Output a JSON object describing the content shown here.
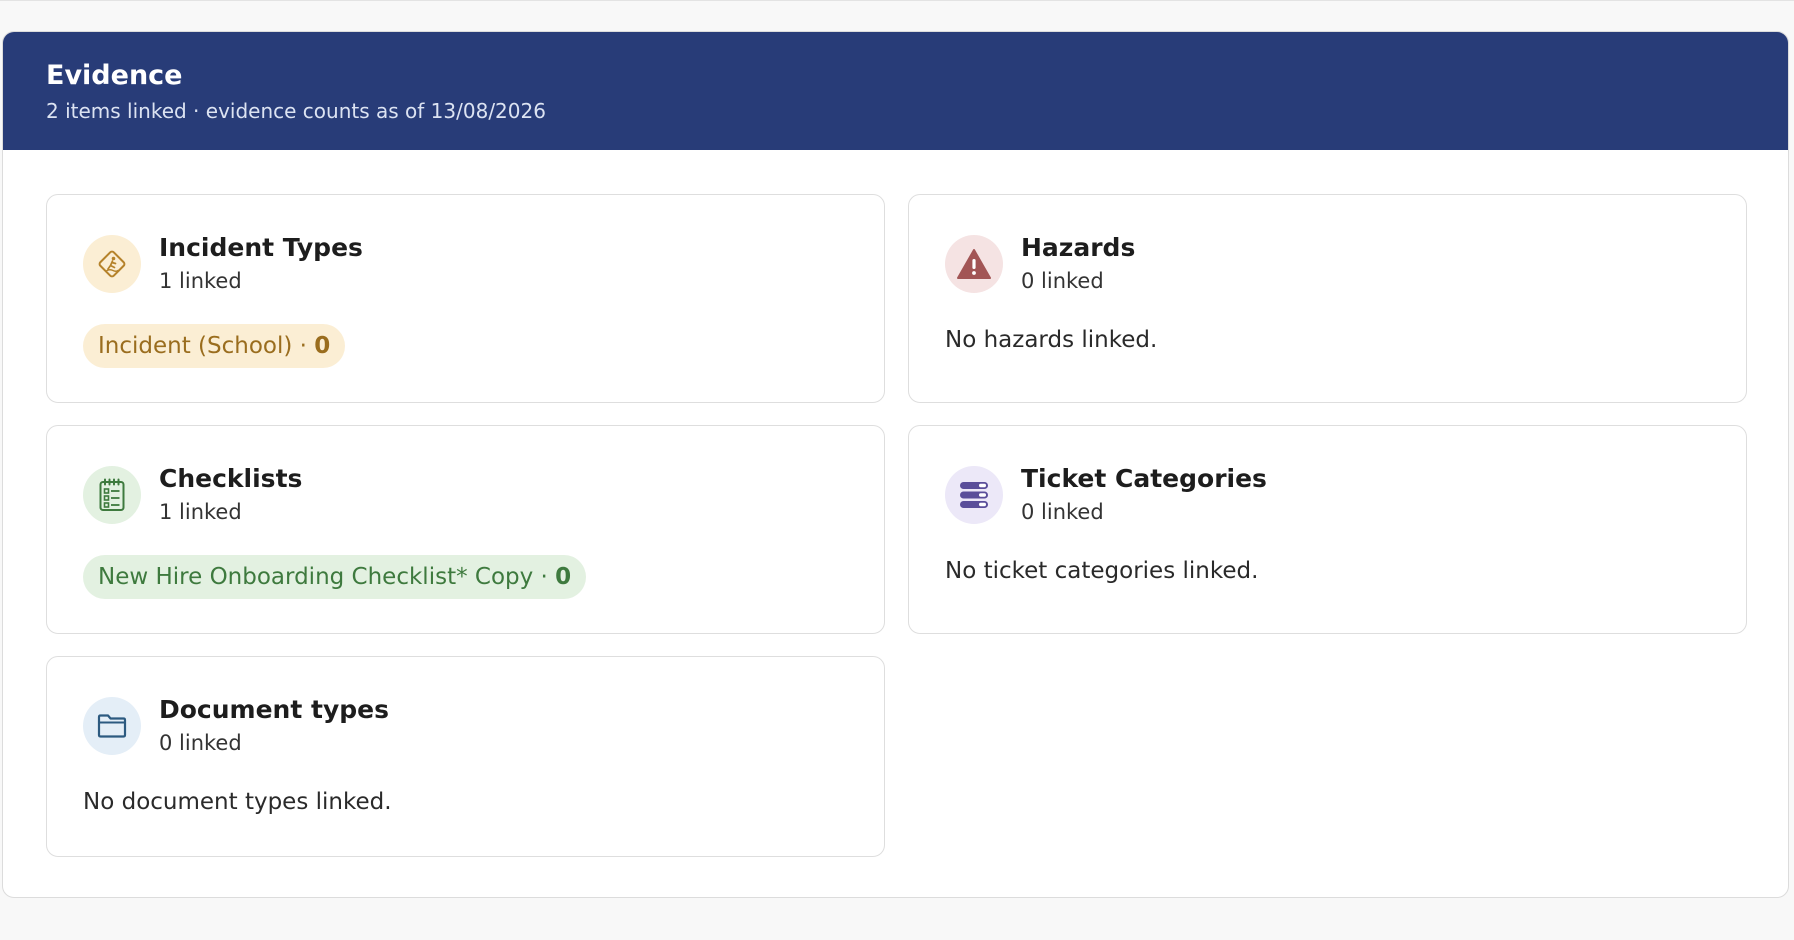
{
  "header": {
    "title": "Evidence",
    "subtitle": "2 items linked · evidence counts as of 13/08/2026"
  },
  "colors": {
    "header_bg": "#283c78",
    "incident_accent": "#9a6d1e",
    "incident_bg": "#fbeed4",
    "hazard_accent": "#a25555",
    "hazard_bg": "#f5e3e3",
    "checklist_accent": "#3e7a3e",
    "checklist_bg": "#e3f1e1",
    "ticket_accent": "#5a4e9a",
    "ticket_bg": "#ece8f8",
    "document_accent": "#2c5a80",
    "document_bg": "#e4eef7"
  },
  "cards": {
    "incident_types": {
      "icon": "wet-floor-icon",
      "title": "Incident Types",
      "count": "1 linked",
      "chip_label": "Incident (School) ·",
      "chip_count": "0"
    },
    "hazards": {
      "icon": "warning-triangle-icon",
      "title": "Hazards",
      "count": "0 linked",
      "empty": "No hazards linked."
    },
    "checklists": {
      "icon": "checklist-icon",
      "title": "Checklists",
      "count": "1 linked",
      "chip_label": "New Hire Onboarding Checklist* Copy ·",
      "chip_count": "0"
    },
    "ticket_categories": {
      "icon": "stacked-list-icon",
      "title": "Ticket Categories",
      "count": "0 linked",
      "empty": "No ticket categories linked."
    },
    "document_types": {
      "icon": "folder-icon",
      "title": "Document types",
      "count": "0 linked",
      "empty": "No document types linked."
    }
  }
}
